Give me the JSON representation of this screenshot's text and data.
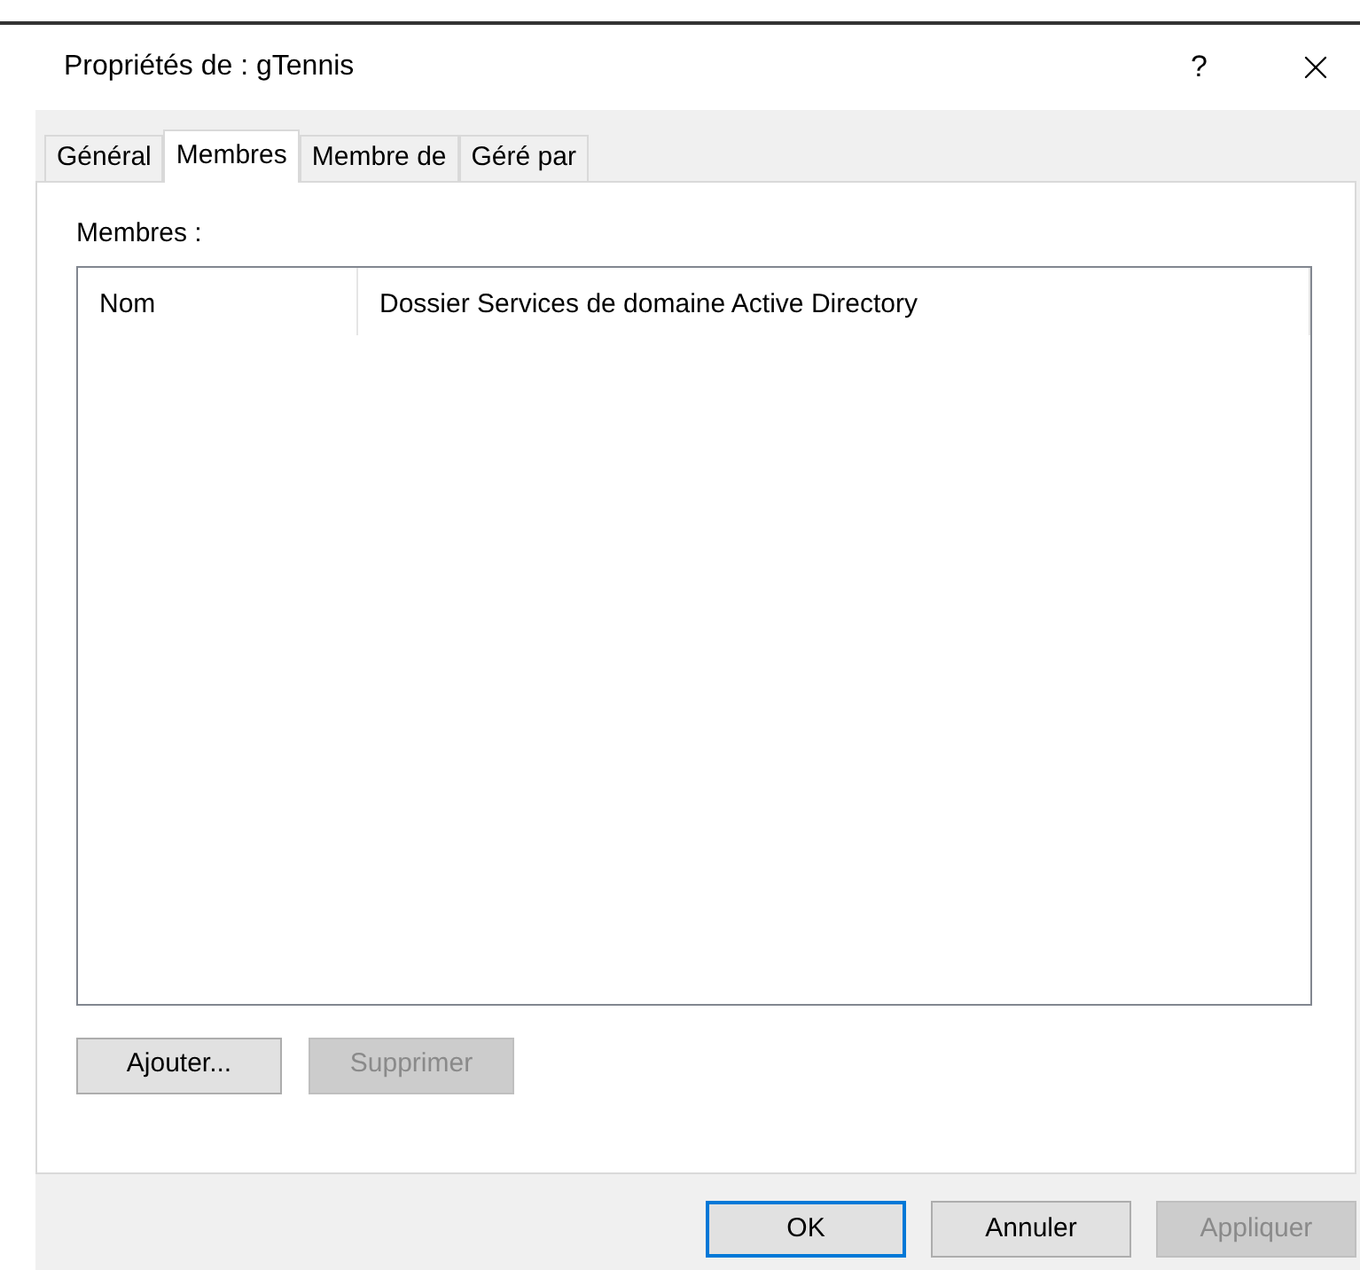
{
  "window": {
    "title": "Propriétés de : gTennis",
    "help": "?"
  },
  "tabs": [
    {
      "label": "Général",
      "selected": false
    },
    {
      "label": "Membres",
      "selected": true
    },
    {
      "label": "Membre de",
      "selected": false
    },
    {
      "label": "Géré par",
      "selected": false
    }
  ],
  "members": {
    "label": "Membres :",
    "columns": [
      "Nom",
      "Dossier Services de domaine Active Directory"
    ]
  },
  "list_buttons": [
    {
      "label": "Ajouter...",
      "disabled": false
    },
    {
      "label": "Supprimer",
      "disabled": true
    }
  ],
  "dialog_buttons": [
    {
      "label": "OK",
      "disabled": false,
      "default": true
    },
    {
      "label": "Annuler",
      "disabled": false,
      "default": false
    },
    {
      "label": "Appliquer",
      "disabled": true,
      "default": false
    }
  ]
}
